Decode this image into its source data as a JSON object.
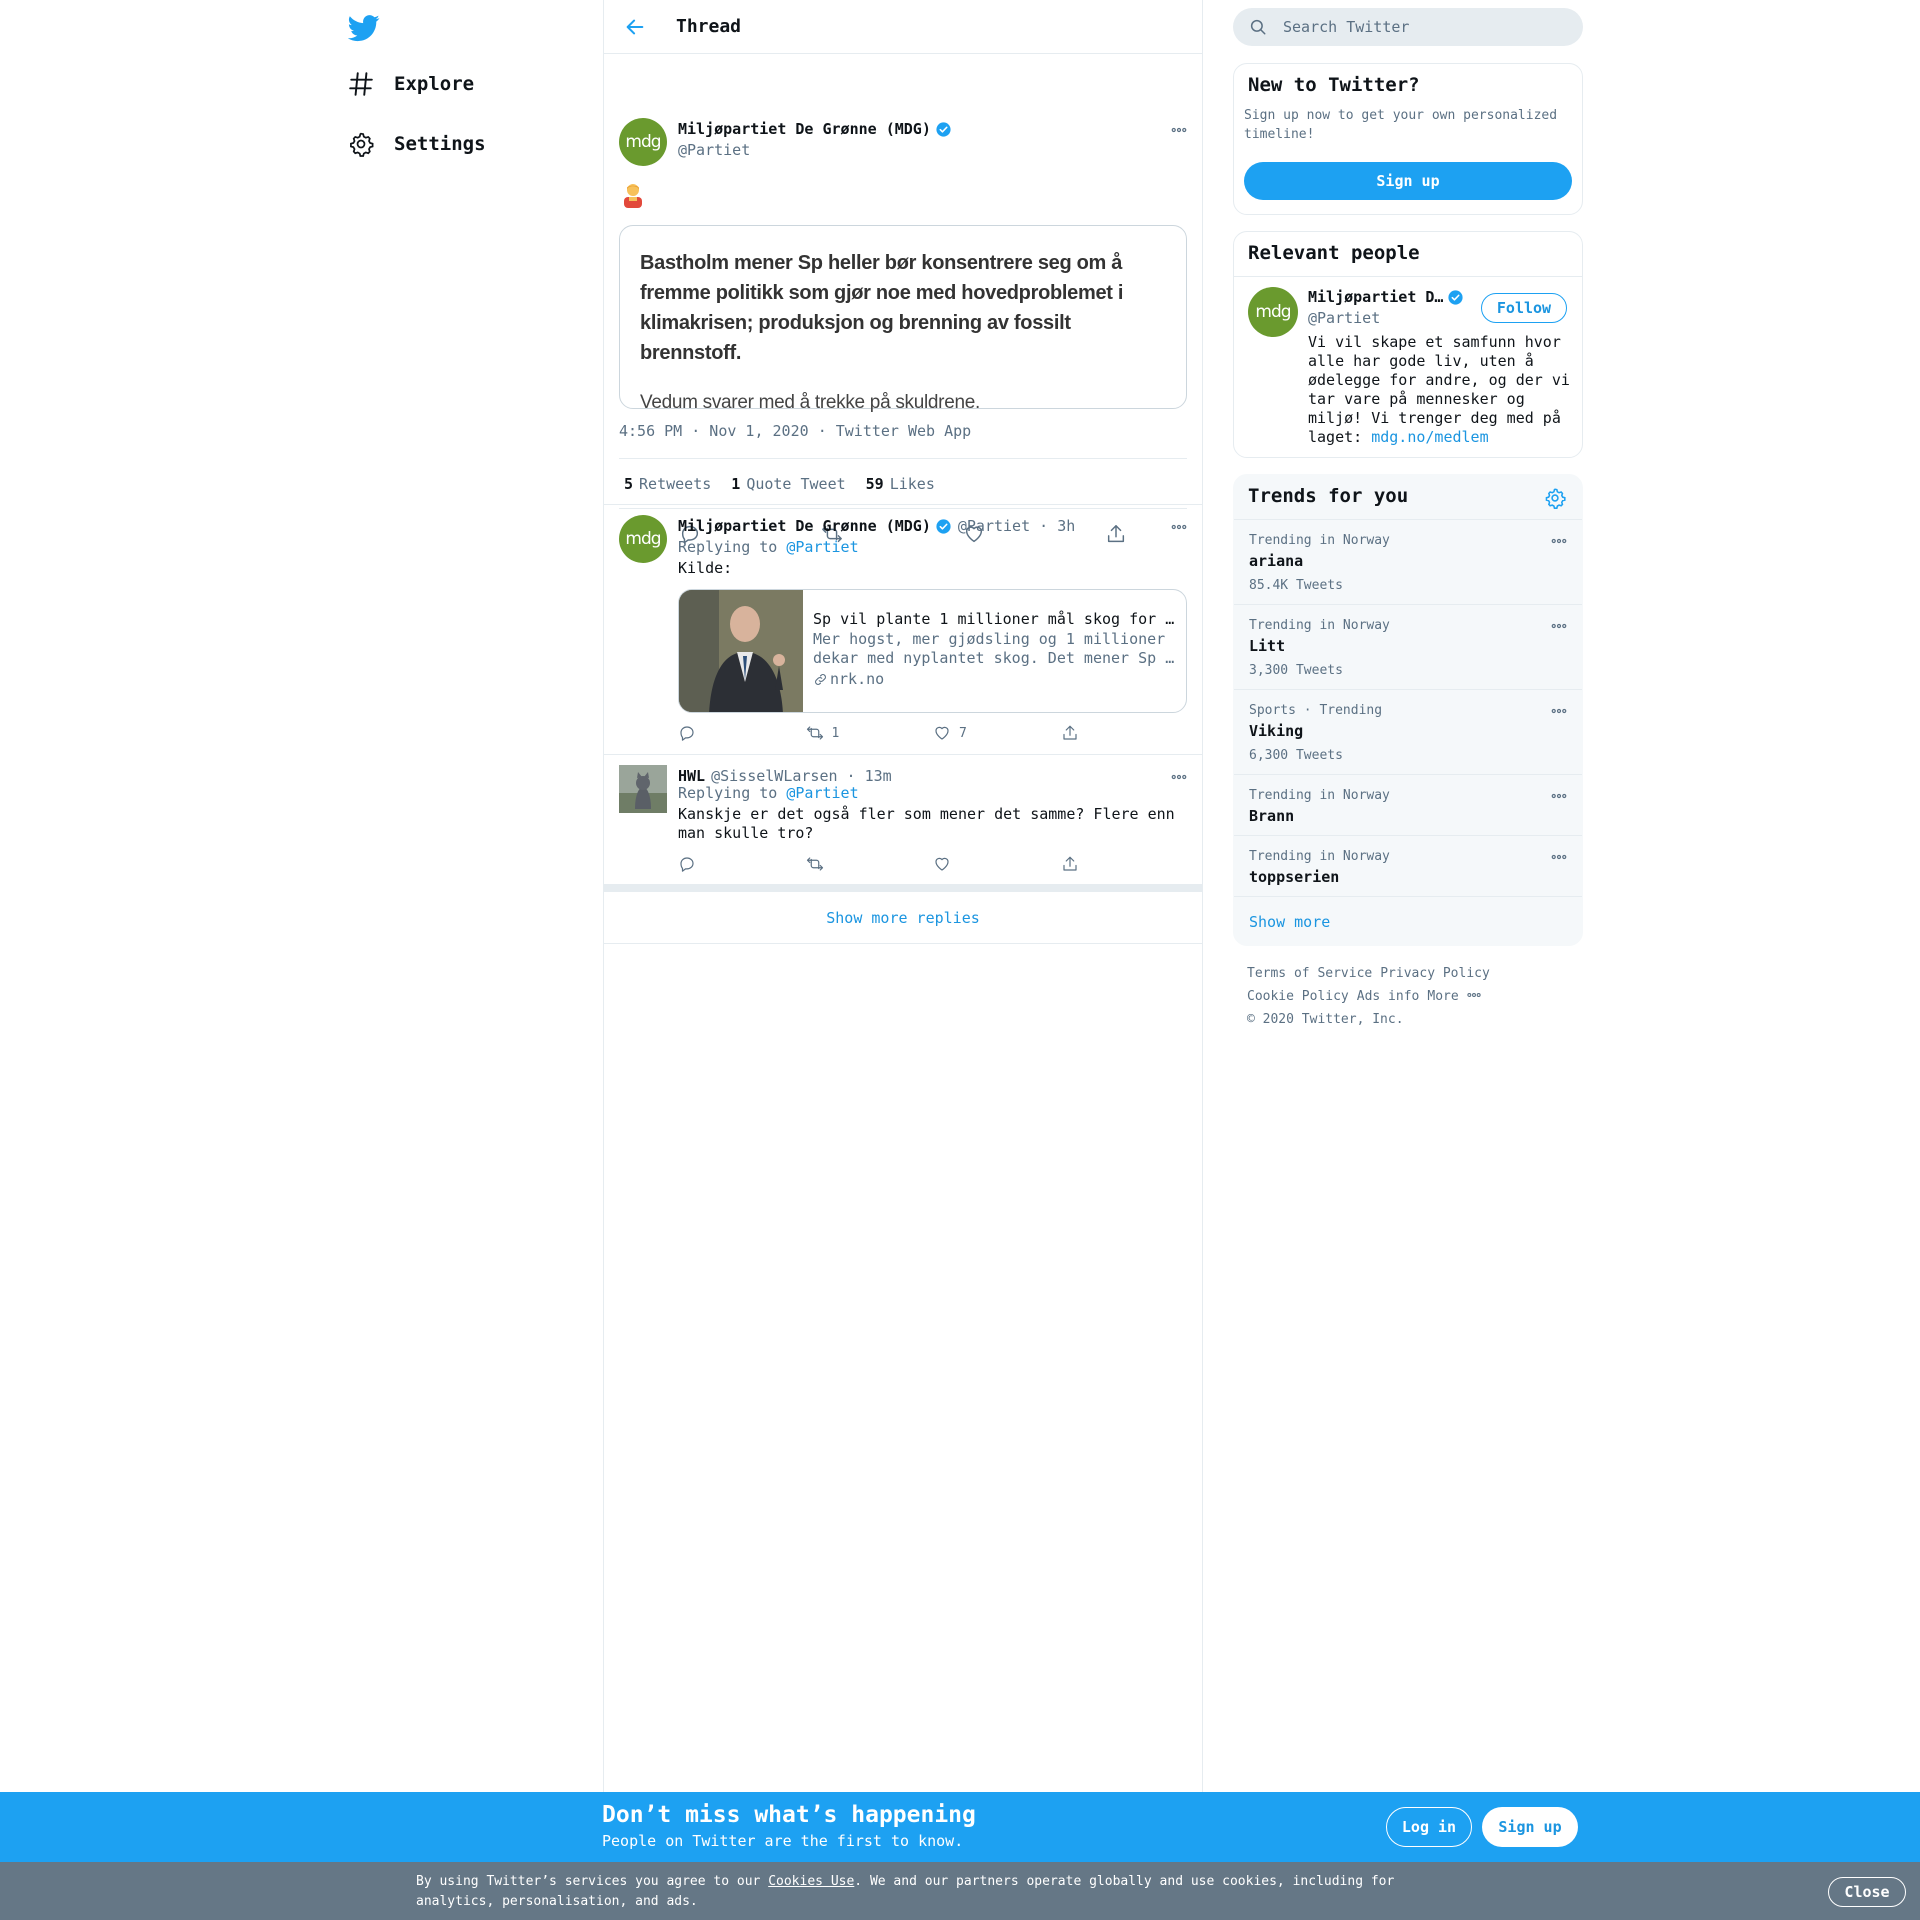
{
  "nav": {
    "explore_label": "Explore",
    "settings_label": "Settings"
  },
  "header": {
    "title": "Thread"
  },
  "main_tweet": {
    "avatar_text": "mdg",
    "name": "Miljøpartiet De Grønne (MDG)",
    "handle": "@Partiet",
    "quote_bold": "Bastholm mener Sp heller bør konsentrere seg om å fremme politikk som gjør noe med hovedproblemet i klimakrisen; produksjon og brenning av fossilt brennstoff.",
    "quote_light": "Vedum svarer med å trekke på skuldrene.",
    "time": "4:56 PM · Nov 1, 2020",
    "source": "Twitter Web App",
    "retweets_count": "5",
    "retweets_label": "Retweets",
    "quotes_count": "1",
    "quotes_label": "Quote Tweet",
    "likes_count": "59",
    "likes_label": "Likes"
  },
  "replies": [
    {
      "avatar_text": "mdg",
      "name": "Miljøpartiet De Grønne (MDG)",
      "handle": "@Partiet",
      "time": "3h",
      "replying_prefix": "Replying to",
      "replying_to": "@Partiet",
      "text": "Kilde:",
      "card_title": "Sp vil plante 1 millioner mål skog for …",
      "card_desc": "Mer hogst, mer gjødsling og 1 millioner dekar med nyplantet skog. Det mener Sp …",
      "card_site": "nrk.no",
      "retweets": "1",
      "likes": "7"
    },
    {
      "name": "HWL",
      "handle": "@SisselWLarsen",
      "time": "13m",
      "replying_prefix": "Replying to",
      "replying_to": "@Partiet",
      "text": "Kanskje er det også fler som mener det samme? Flere enn man skulle tro?"
    }
  ],
  "show_more_replies": "Show more replies",
  "search": {
    "placeholder": "Search Twitter"
  },
  "new_to_twitter": {
    "title": "New to Twitter?",
    "text": "Sign up now to get your own personalized timeline!",
    "button": "Sign up"
  },
  "relevant_people": {
    "title": "Relevant people",
    "avatar_text": "mdg",
    "name": "Miljøpartiet D…",
    "handle": "@Partiet",
    "follow": "Follow",
    "bio": "Vi vil skape et samfunn hvor alle har gode liv, uten å ødelegge for andre, og der vi tar vare på mennesker og miljø! Vi trenger deg med på laget:",
    "bio_link": "mdg.no/medlem"
  },
  "trends": {
    "title": "Trends for you",
    "items": [
      {
        "context": "Trending in Norway",
        "name": "ariana",
        "count": "85.4K Tweets"
      },
      {
        "context": "Trending in Norway",
        "name": "Litt",
        "count": "3,300 Tweets"
      },
      {
        "context": "Sports · Trending",
        "name": "Viking",
        "count": "6,300 Tweets"
      },
      {
        "context": "Trending in Norway",
        "name": "Brann",
        "count": ""
      },
      {
        "context": "Trending in Norway",
        "name": "toppserien",
        "count": ""
      }
    ],
    "show_more": "Show more"
  },
  "footer": {
    "terms": "Terms of Service",
    "privacy": "Privacy Policy",
    "cookie": "Cookie Policy",
    "ads": "Ads info",
    "more": "More",
    "copyright": "© 2020 Twitter, Inc."
  },
  "signup_bar": {
    "title": "Don’t miss what’s happening",
    "subtitle": "People on Twitter are the first to know.",
    "login": "Log in",
    "signup": "Sign up"
  },
  "cookie_bar": {
    "text_before": "By using Twitter’s services you agree to our ",
    "link": "Cookies Use",
    "text_after": ". We and our partners operate globally and use cookies, including for analytics, personalisation, and ads.",
    "close": "Close"
  },
  "colors": {
    "accent": "#1da1f2",
    "link": "#1b95e0",
    "muted": "#5b7083",
    "mdg_green": "#6a9a2e"
  }
}
